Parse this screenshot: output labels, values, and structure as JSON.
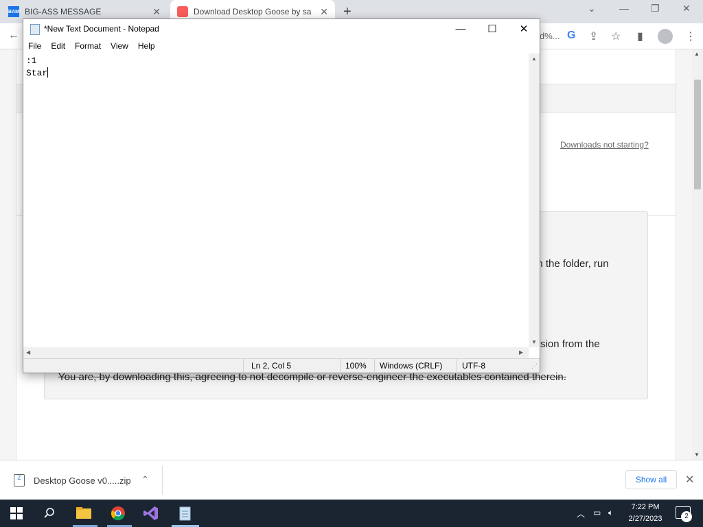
{
  "browser": {
    "tabs": [
      {
        "label": "BIG-ASS MESSAGE",
        "favicon": "BAM"
      },
      {
        "label": "Download Desktop Goose by sa"
      }
    ],
    "zoom_fragment": "d%...",
    "page": {
      "downloads_link": "Downloads not starting?",
      "info_fragment": "en the folder, run",
      "info_para1": "Creating promotional and marketing material using the goose as a base without contractual written permission from the developer is against the terms of use.",
      "info_para2": "You are, by downloading this, agreeing to not decompile or reverse-engineer the executables contained therein."
    },
    "download_bar": {
      "file": "Desktop Goose v0.....zip",
      "show_all": "Show all"
    }
  },
  "notepad": {
    "title": "*New Text Document - Notepad",
    "menu": [
      "File",
      "Edit",
      "Format",
      "View",
      "Help"
    ],
    "lines": [
      ":1",
      "Star"
    ],
    "status": {
      "position": "Ln 2, Col 5",
      "zoom": "100%",
      "line_ending": "Windows (CRLF)",
      "encoding": "UTF-8"
    }
  },
  "taskbar": {
    "time": "7:22 PM",
    "date": "2/27/2023",
    "notification_count": "2"
  },
  "colors": {
    "taskbar": "#1b2532",
    "tabstrip": "#dee1e6",
    "link_blue": "#1a73e8"
  }
}
